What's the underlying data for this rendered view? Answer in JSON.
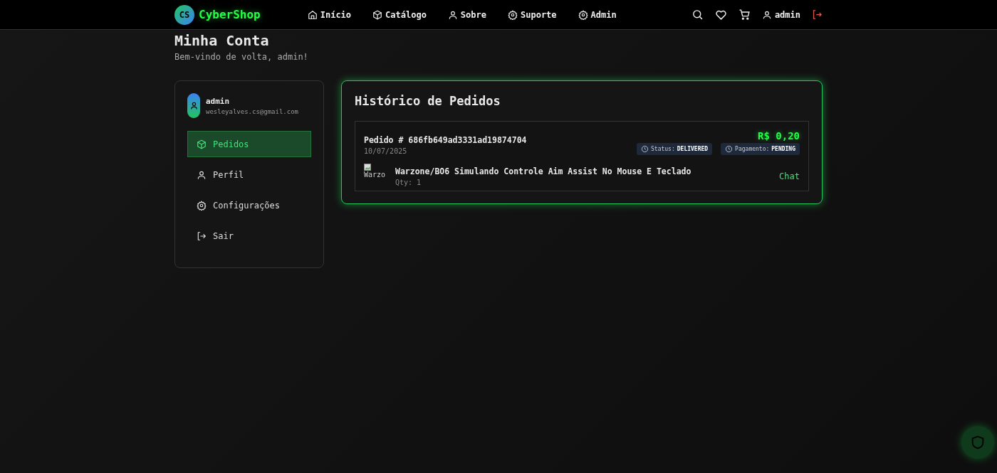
{
  "nav": {
    "logo_badge": "CS",
    "logo_text": "CyberShop",
    "links": [
      {
        "label": "Início"
      },
      {
        "label": "Catálogo"
      },
      {
        "label": "Sobre"
      },
      {
        "label": "Suporte"
      },
      {
        "label": "Admin"
      }
    ],
    "user": "admin"
  },
  "page": {
    "title": "Minha Conta",
    "subtitle": "Bem-vindo de volta, admin!"
  },
  "sidebar": {
    "name": "admin",
    "email": "wesleyalves.cs@gmail.com",
    "items": [
      {
        "label": "Pedidos",
        "selected": true
      },
      {
        "label": "Perfil",
        "selected": false
      },
      {
        "label": "Configurações",
        "selected": false
      },
      {
        "label": "Sair",
        "selected": false
      }
    ]
  },
  "orders": {
    "title": "Histórico de Pedidos",
    "items": [
      {
        "number": "Pedido # 686fb649ad3331ad19874704",
        "date": "10/07/2025",
        "total": "R$ 0,20",
        "badges": [
          {
            "label": "Status:",
            "value": "DELIVERED"
          },
          {
            "label": "Pagamento:",
            "value": "PENDING"
          }
        ],
        "products": [
          {
            "image_alt": "Warzo",
            "name": "Warzone/BO6 Simulando Controle Aim Assist No Mouse E Teclado",
            "qty": "Qty: 1",
            "action": "Chat"
          }
        ]
      }
    ]
  }
}
